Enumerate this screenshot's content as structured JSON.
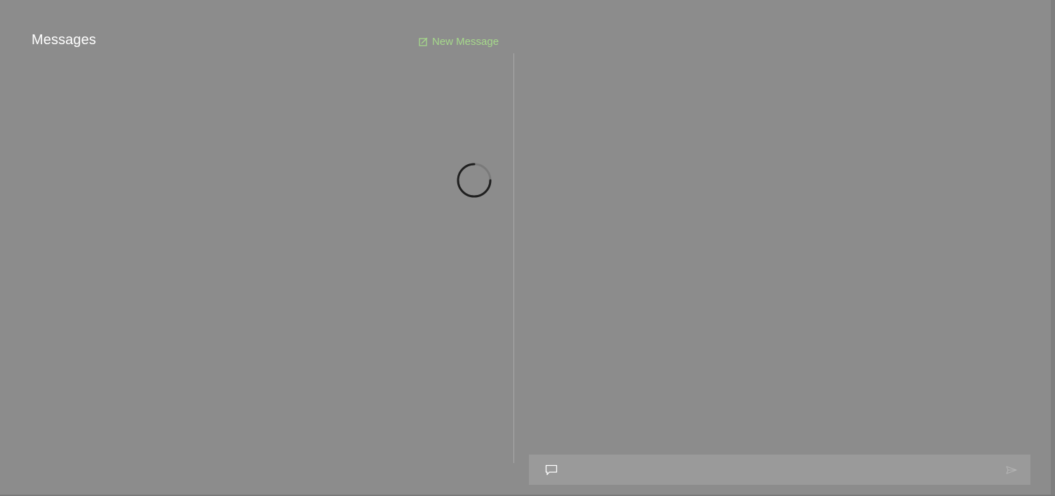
{
  "header": {
    "title": "Messages",
    "new_message_label": "New Message"
  },
  "composer": {
    "placeholder": "",
    "value": ""
  },
  "icons": {
    "new_message": "compose-icon",
    "loading": "loading-spinner-icon",
    "chat": "chat-bubble-icon",
    "send": "send-icon"
  },
  "colors": {
    "background": "#8c8c8c",
    "accent": "#a6d98b",
    "title": "#ffffff",
    "composer_bg": "#9a9a9a"
  }
}
